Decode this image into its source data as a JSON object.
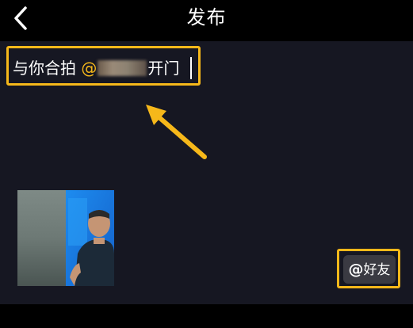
{
  "header": {
    "title": "发布",
    "back_icon": "chevron-left-icon"
  },
  "caption": {
    "prefix": "与你合拍 ",
    "mention_start": "@",
    "mention_visible_partial": "开门"
  },
  "friend_button": {
    "icon_glyph": "@",
    "label": "好友"
  },
  "thumbnail": {
    "description_icon": "video-thumbnail"
  },
  "colors": {
    "highlight": "#f6b81a",
    "panel_bg": "#161722",
    "page_bg": "#000000"
  }
}
